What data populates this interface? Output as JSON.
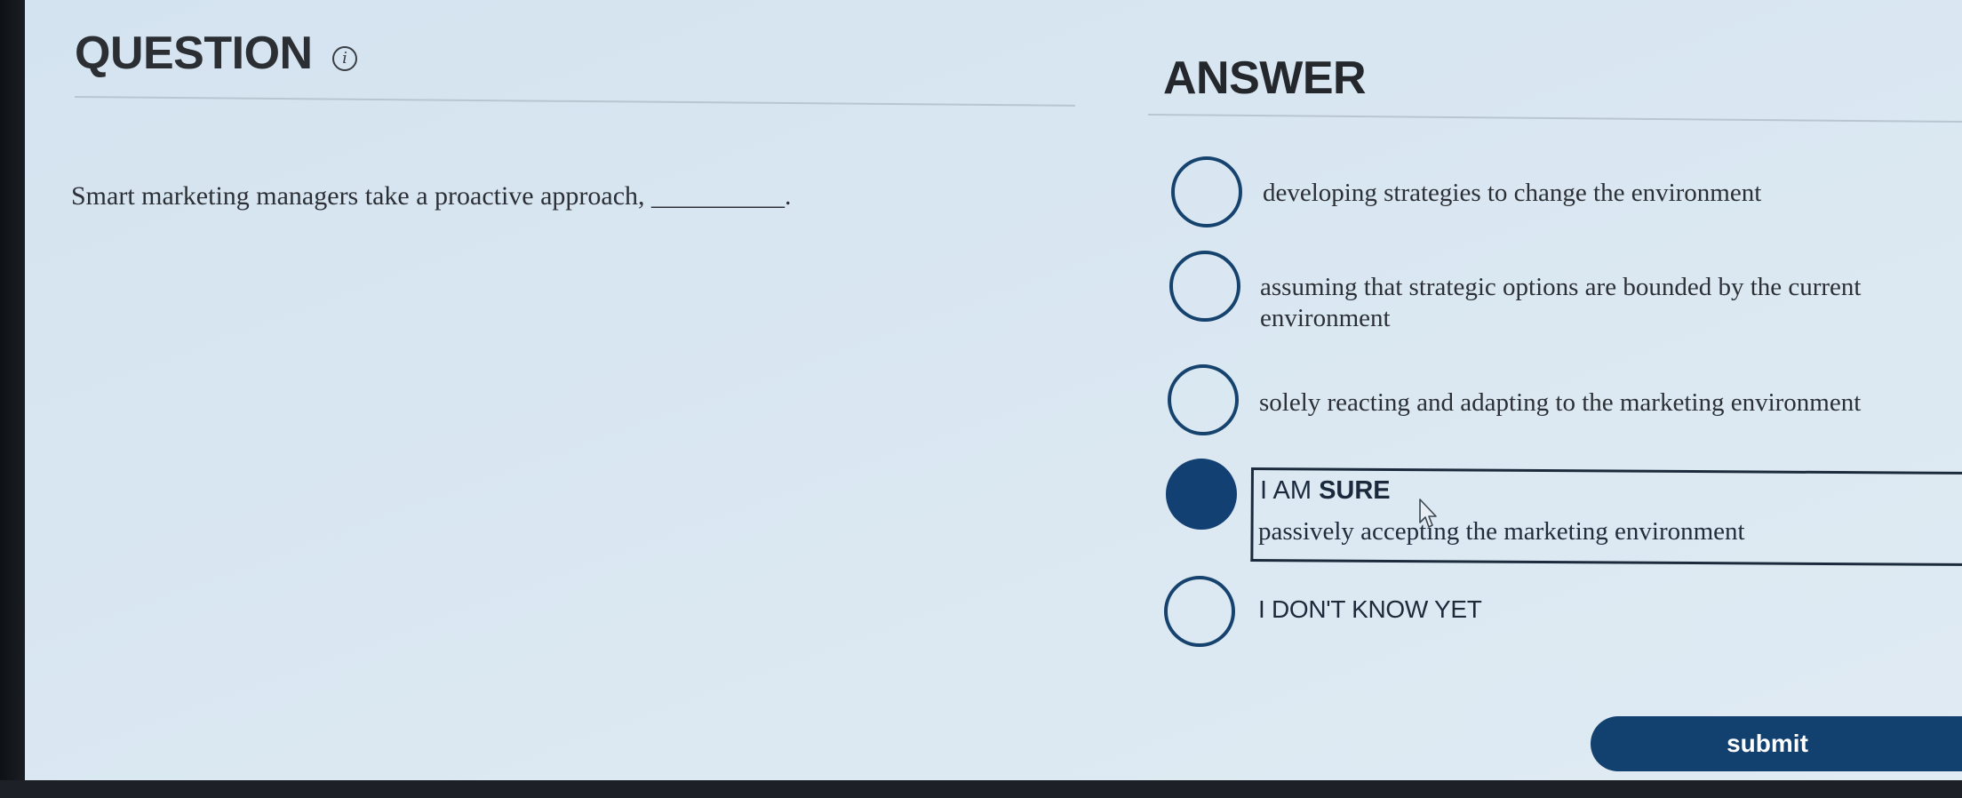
{
  "question": {
    "heading": "QUESTION",
    "info_icon": "info-icon",
    "text": "Smart marketing managers take a proactive approach, __________."
  },
  "answer": {
    "heading": "ANSWER",
    "options": [
      {
        "label": "developing strategies to change the environment",
        "selected": false
      },
      {
        "label": "assuming that strategic options are bounded by the current environment",
        "selected": false
      },
      {
        "label": "solely reacting and adapting to the marketing environment",
        "selected": false
      },
      {
        "label": "passively accepting the marketing environment",
        "selected": true,
        "confidence_prefix": "I AM ",
        "confidence_strong": "SURE"
      },
      {
        "label": "I DON'T KNOW YET",
        "selected": false
      }
    ]
  },
  "submit": {
    "label": "submit"
  },
  "colors": {
    "accent": "#134072",
    "background": "#d8e6f1",
    "text": "#2c3036"
  }
}
